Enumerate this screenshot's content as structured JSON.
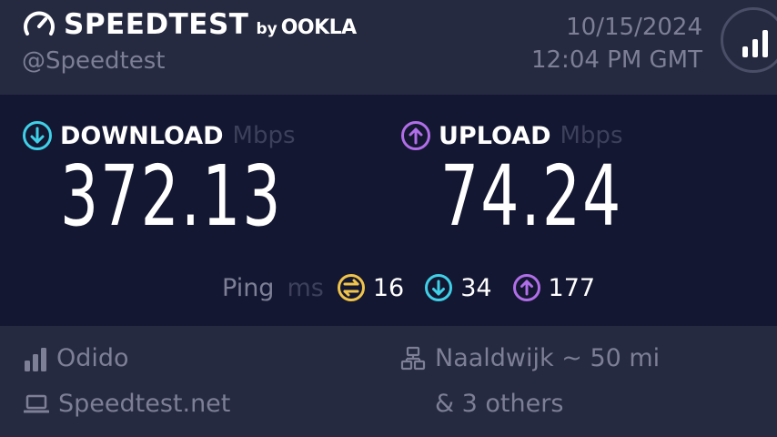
{
  "header": {
    "brand": "SPEEDTEST",
    "by": "by",
    "partner": "OOKLA",
    "handle": "@Speedtest",
    "date": "10/15/2024",
    "time": "12:04 PM GMT"
  },
  "download": {
    "label": "DOWNLOAD",
    "unit": "Mbps",
    "value": "372.13",
    "color": "#3fd0e8"
  },
  "upload": {
    "label": "UPLOAD",
    "unit": "Mbps",
    "value": "74.24",
    "color": "#b06ee8"
  },
  "ping": {
    "label": "Ping",
    "unit": "ms",
    "idle": "16",
    "download": "34",
    "upload": "177",
    "idle_color": "#f0c44a"
  },
  "footer": {
    "provider": "Odido",
    "client": "Speedtest.net",
    "server": "Naaldwijk ~ 50 mi",
    "others": "& 3 others"
  },
  "icons": [
    "gauge-icon",
    "signal-bars-icon",
    "download-arrow-icon",
    "upload-arrow-icon",
    "ping-idle-icon",
    "laptop-icon",
    "server-icon"
  ]
}
